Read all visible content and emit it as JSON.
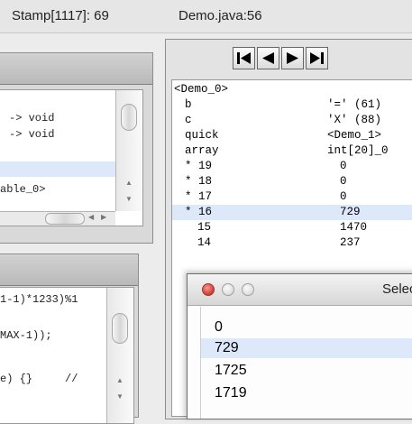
{
  "status": {
    "stamp": "Stamp[1117]: 69",
    "file": "Demo.java:56"
  },
  "left_top": {
    "lines": [
      "-> void",
      "-> void",
      "able_0>"
    ]
  },
  "left_bottom": {
    "lines": [
      "1-1)*1233)%1",
      "MAX-1));",
      "e) {}     //"
    ]
  },
  "nav": {
    "first_icon": "skip-to-start-icon",
    "prev_icon": "step-back-icon",
    "next_icon": "step-forward-icon",
    "last_icon": "skip-to-end-icon"
  },
  "inspector": {
    "header": "<Demo_0>",
    "rows": [
      {
        "name": "b",
        "value": "'=' (61)"
      },
      {
        "name": "c",
        "value": "'X' (88)"
      },
      {
        "name": "quick",
        "value": "<Demo_1>"
      },
      {
        "name": "array",
        "value": "int[20]_0"
      },
      {
        "name": "* 19",
        "value": "0"
      },
      {
        "name": "* 18",
        "value": "0"
      },
      {
        "name": "* 17",
        "value": "0"
      },
      {
        "name": "* 16",
        "value": "729"
      },
      {
        "name": "15",
        "value": "1470"
      },
      {
        "name": "14",
        "value": "237"
      }
    ],
    "selected_row": 7
  },
  "select_window": {
    "title": "Select",
    "items": [
      "0",
      "729",
      "1725",
      "1719"
    ],
    "selected_item": 1
  },
  "colors": {
    "highlight": "#dde9fb",
    "close_light": "#d9473e"
  }
}
